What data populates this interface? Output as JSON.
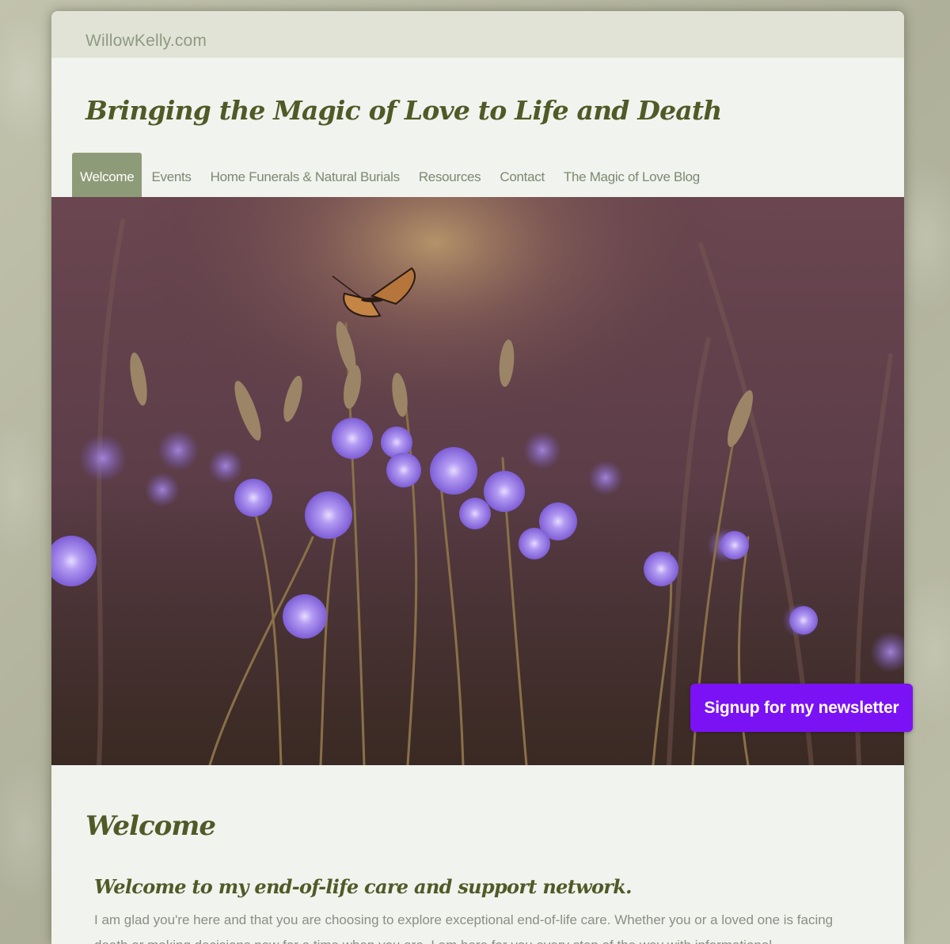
{
  "site": {
    "name": "WillowKelly.com",
    "tagline": "Bringing the Magic of Love to Life and Death"
  },
  "nav": {
    "items": [
      {
        "label": "Welcome",
        "active": true
      },
      {
        "label": "Events",
        "active": false
      },
      {
        "label": "Home Funerals & Natural Burials",
        "active": false
      },
      {
        "label": "Resources",
        "active": false
      },
      {
        "label": "Contact",
        "active": false
      },
      {
        "label": "The Magic of Love Blog",
        "active": false
      }
    ]
  },
  "hero": {
    "image_subject": "butterfly-on-wildflowers"
  },
  "newsletter": {
    "label": "Signup for my newsletter"
  },
  "content": {
    "title": "Welcome",
    "subtitle": "Welcome to my end-of-life care and support network.",
    "paragraph": "I am glad you're here and that you are choosing to explore exceptional end-of-life care. Whether you or a loved one is facing death or making decisions now for a time when you are, I am here for you every step of the way with informational"
  },
  "colors": {
    "accent": "#7a12f5",
    "nav_active": "#8e9b78",
    "heading": "#4f5a26",
    "topbar": "#e0e3d6",
    "page_bg": "#f1f3ef"
  }
}
